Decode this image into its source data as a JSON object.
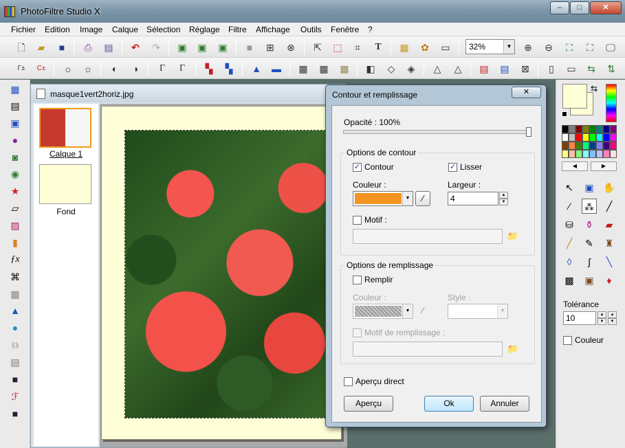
{
  "window": {
    "title": "PhotoFiltre Studio X",
    "min_label": "–",
    "max_label": "□",
    "close_label": "✕"
  },
  "menu": [
    "Fichier",
    "Edition",
    "Image",
    "Calque",
    "Sélection",
    "Réglage",
    "Filtre",
    "Affichage",
    "Outils",
    "Fenêtre",
    "?"
  ],
  "toolbar1": {
    "zoom": "32%"
  },
  "document": {
    "title": "masque1vert2horiz.jpg",
    "layers": [
      {
        "label": "Calque 1"
      },
      {
        "label": "Fond"
      }
    ]
  },
  "dialog": {
    "title": "Contour et remplissage",
    "close_label": "✕",
    "opacity_label": "Opacité : 100%",
    "opacity_value": 100,
    "contour_group": {
      "title": "Options de contour",
      "contour_label": "Contour",
      "contour_checked": true,
      "lisser_label": "Lisser",
      "lisser_checked": true,
      "couleur_label": "Couleur :",
      "couleur_value": "#f39322",
      "largeur_label": "Largeur :",
      "largeur_value": "4",
      "motif_label": "Motif :",
      "motif_checked": false
    },
    "fill_group": {
      "title": "Options de remplissage",
      "remplir_label": "Remplir",
      "remplir_checked": false,
      "couleur_label": "Couleur :",
      "couleur_value": "#b0b0b0",
      "style_label": "Style :",
      "motif_label": "Motif de remplissage :",
      "motif_checked": false
    },
    "apercu_direct_label": "Aperçu direct",
    "apercu_direct_checked": false,
    "buttons": {
      "apercu": "Aperçu",
      "ok": "Ok",
      "annuler": "Annuler"
    }
  },
  "right_panel": {
    "tolerance_label": "Tolérance",
    "tolerance_value": "10",
    "couleur_label": "Couleur",
    "couleur_checked": false,
    "foreground_color": "#ffffd7",
    "background_color": "#ffffd7",
    "palette": [
      "#000000",
      "#808080",
      "#800000",
      "#808000",
      "#008000",
      "#008080",
      "#000080",
      "#800080",
      "#ffffff",
      "#c0c0c0",
      "#ff0000",
      "#ffff00",
      "#00ff00",
      "#00ffff",
      "#0000ff",
      "#ff00ff",
      "#804000",
      "#ff8040",
      "#408000",
      "#00ff80",
      "#004080",
      "#8080ff",
      "#400080",
      "#ff0080",
      "#ffff80",
      "#ffc0a0",
      "#80ff80",
      "#80ffff",
      "#80c0ff",
      "#c0c0ff",
      "#ff80c0",
      "#ffe0e0"
    ]
  }
}
